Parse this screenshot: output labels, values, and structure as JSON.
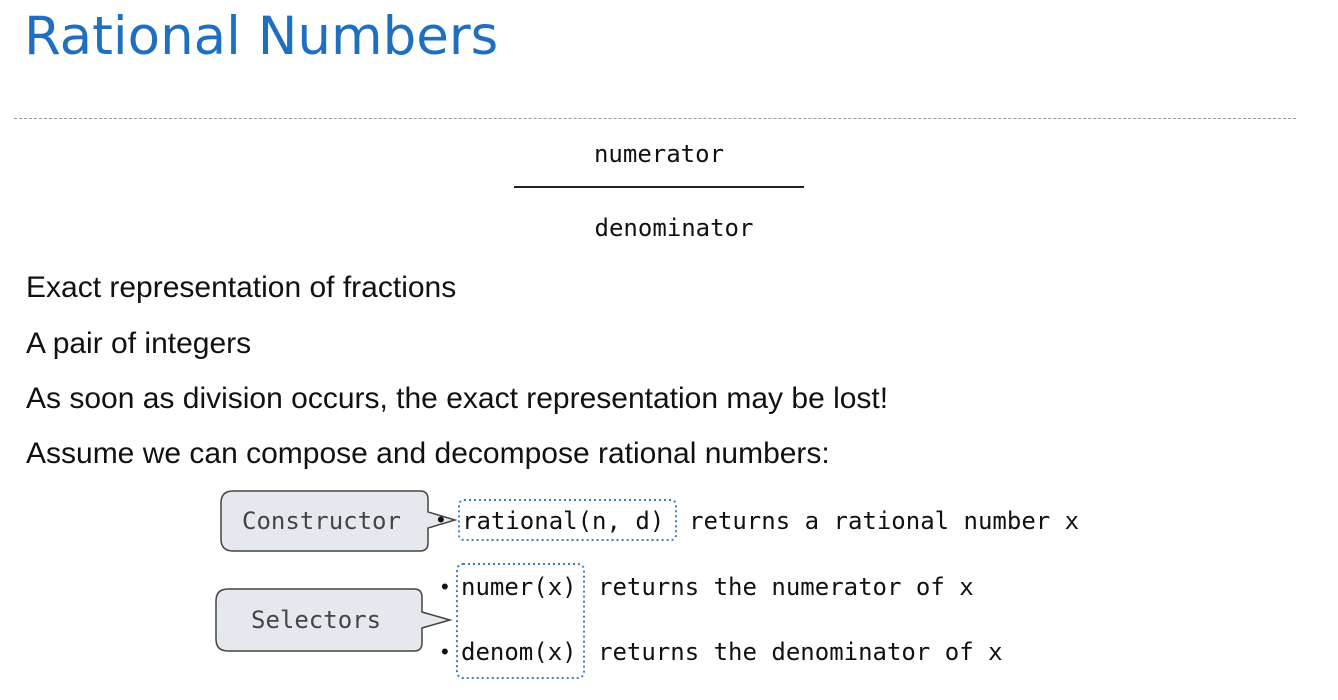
{
  "slide": {
    "title": "Rational Numbers",
    "fraction": {
      "numerator": "numerator",
      "denominator": "denominator"
    },
    "bullets": [
      "Exact representation of fractions",
      "A pair of integers",
      "As soon as division occurs, the exact representation may be lost!",
      "Assume we can compose and decompose rational numbers:"
    ],
    "constructor": {
      "label": "Constructor",
      "call": "rational(n, d)",
      "description": "returns a rational number x"
    },
    "selectors": {
      "label": "Selectors",
      "items": [
        {
          "call": "numer(x)",
          "description": "returns the numerator of x"
        },
        {
          "call": "denom(x)",
          "description": "returns the denominator of x"
        }
      ]
    }
  }
}
